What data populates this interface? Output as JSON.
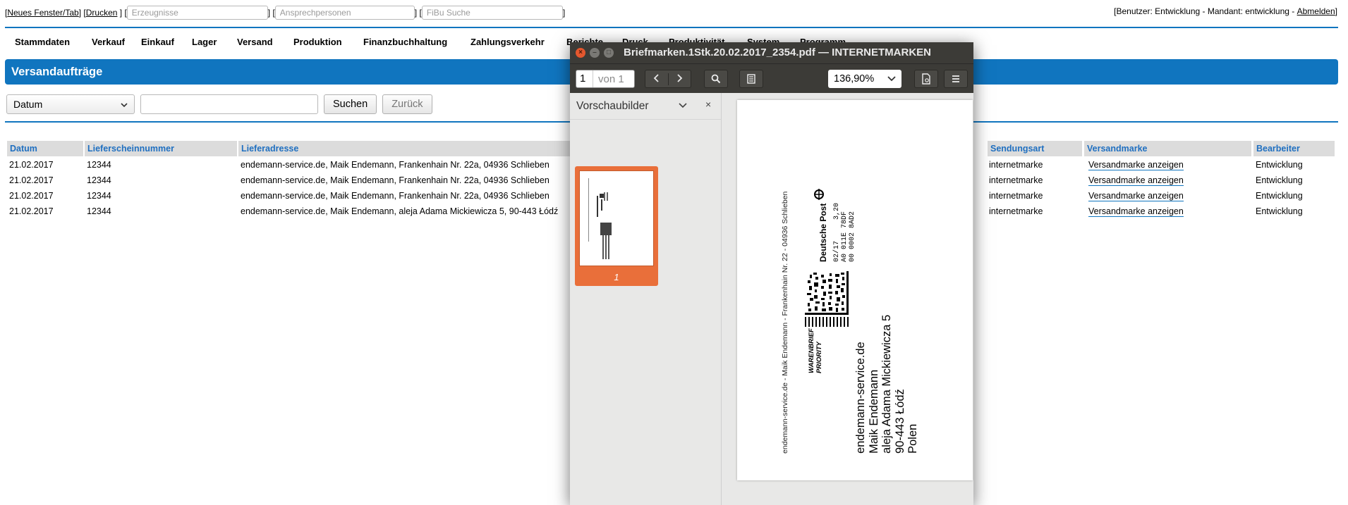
{
  "topbar": {
    "new_window": "Neues Fenster/Tab",
    "print": "Drucken",
    "search_products_placeholder": "Erzeugnisse",
    "search_contacts_placeholder": "Ansprechpersonen",
    "search_fibu_placeholder": "FiBu Suche",
    "user_info": "[Benutzer: Entwicklung - Mandant: entwicklung -",
    "logout": "Abmelden",
    "user_info_end": "]"
  },
  "menu": [
    "Stammdaten",
    "Verkauf",
    "Einkauf",
    "Lager",
    "Versand",
    "Produktion",
    "Finanzbuchhaltung",
    "Zahlungsverkehr",
    "Berichte",
    "Druck",
    "Produktivität",
    "System",
    "Programm"
  ],
  "page_title": "Versandaufträge",
  "search": {
    "select_value": "Datum",
    "input_value": "",
    "search_btn": "Suchen",
    "back_btn": "Zurück"
  },
  "table": {
    "headers": {
      "datum": "Datum",
      "lieferschein": "Lieferscheinnummer",
      "adresse": "Lieferadresse",
      "sendungsart": "Sendungsart",
      "versandmarke": "Versandmarke",
      "bearbeiter": "Bearbeiter"
    },
    "rows": [
      {
        "datum": "21.02.2017",
        "nr": "12344",
        "adresse": "endemann-service.de, Maik Endemann, Frankenhain Nr. 22a, 04936 Schlieben",
        "art": "internetmarke",
        "link": "Versandmarke anzeigen",
        "bearbeiter": "Entwicklung"
      },
      {
        "datum": "21.02.2017",
        "nr": "12344",
        "adresse": "endemann-service.de, Maik Endemann, Frankenhain Nr. 22a, 04936 Schlieben",
        "art": "internetmarke",
        "link": "Versandmarke anzeigen",
        "bearbeiter": "Entwicklung"
      },
      {
        "datum": "21.02.2017",
        "nr": "12344",
        "adresse": "endemann-service.de, Maik Endemann, Frankenhain Nr. 22a, 04936 Schlieben",
        "art": "internetmarke",
        "link": "Versandmarke anzeigen",
        "bearbeiter": "Entwicklung"
      },
      {
        "datum": "21.02.2017",
        "nr": "12344",
        "adresse": "endemann-service.de, Maik Endemann, aleja Adama Mickiewicza 5, 90-443 Łódź",
        "art": "internetmarke",
        "link": "Versandmarke anzeigen",
        "bearbeiter": "Entwicklung"
      }
    ]
  },
  "pdf": {
    "title": "Briefmarken.1Stk.20.02.2017_2354.pdf — INTERNETMARKEN",
    "page_num": "1",
    "page_of": "von 1",
    "zoom": "136,90%",
    "sidebar_title": "Vorschaubilder",
    "thumb_label": "1",
    "label": {
      "sender": "endemann-service.de - Maik Endemann - Frankenhain Nr. 22 - 04936 Schlieben",
      "brand": "Deutsche Post",
      "code_line1": "02/17     3,20",
      "code_line2": "A0 011E 78DF",
      "code_line3": "00 0002 8AD2",
      "product_line1": "WARENBRIEF",
      "product_line2": "PRIORITY",
      "addr1": "endemann-service.de",
      "addr2": "Maik Endemann",
      "addr3": "aleja Adama Mickiewicza 5",
      "addr4": "90-443 Łódź",
      "addr5": "Polen"
    }
  }
}
